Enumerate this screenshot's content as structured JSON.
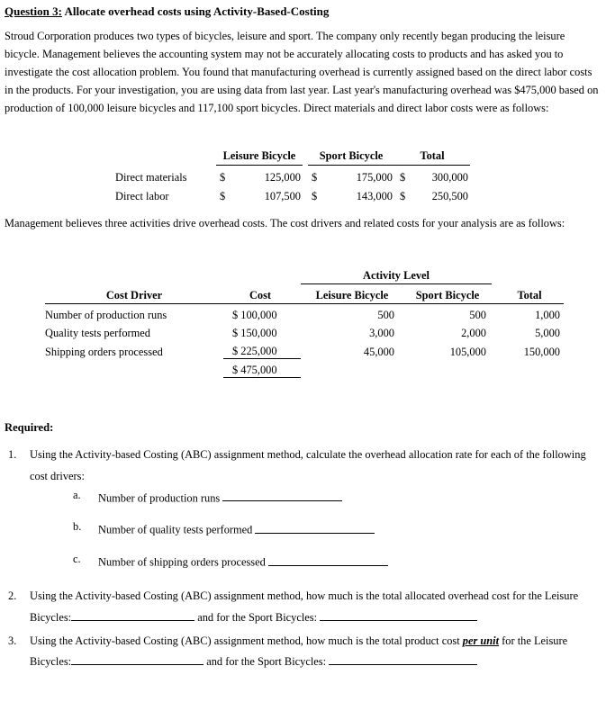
{
  "heading": {
    "question_label": "Question 3:",
    "question_title": " Allocate overhead costs using Activity-Based-Costing"
  },
  "intro_paragraph": "Stroud Corporation produces two types of bicycles, leisure and sport. The company only recently began producing the leisure bicycle. Management believes the accounting system may not be accurately allocating costs to products and has asked you to investigate the cost allocation problem. You found that manufacturing overhead is currently assigned based on the direct labor costs in the products. For your investigation, you are using data from last year. Last year's manufacturing overhead was $475,000 based on production of 100,000 leisure bicycles and 117,100 sport bicycles. Direct materials and direct labor costs were as follows:",
  "mid_paragraph": "Management believes three activities drive overhead costs. The cost drivers and related costs for your analysis are as follows:",
  "cost_table": {
    "headers": [
      "Leisure Bicycle",
      "Sport Bicycle",
      "Total"
    ],
    "currency_symbol": "$",
    "rows": [
      {
        "label": "Direct materials",
        "leisure": "125,000",
        "sport": "175,000",
        "total": "300,000"
      },
      {
        "label": "Direct labor",
        "leisure": "107,500",
        "sport": "143,000",
        "total": "250,500"
      }
    ]
  },
  "driver_table": {
    "span_header": "Activity Level",
    "headers": {
      "driver": "Cost Driver",
      "cost": "Cost",
      "leisure": "Leisure Bicycle",
      "sport": "Sport Bicycle",
      "total": "Total"
    },
    "rows": [
      {
        "driver": "Number of production runs",
        "cost": "$ 100,000",
        "leisure": "500",
        "sport": "500",
        "total": "1,000"
      },
      {
        "driver": "Quality tests performed",
        "cost": "$ 150,000",
        "leisure": "3,000",
        "sport": "2,000",
        "total": "5,000"
      },
      {
        "driver": "Shipping orders processed",
        "cost": "$ 225,000",
        "leisure": "45,000",
        "sport": "105,000",
        "total": "150,000"
      }
    ],
    "cost_total": "$  475,000"
  },
  "required": {
    "title": "Required:",
    "items": [
      {
        "number": "1.",
        "text": "Using the Activity-based Costing (ABC) assignment method, calculate the overhead allocation rate for each of the following cost drivers:",
        "subitems": [
          {
            "letter": "a.",
            "text": "Number of production runs"
          },
          {
            "letter": "b.",
            "text": "Number of quality tests performed"
          },
          {
            "letter": "c.",
            "text": "Number of shipping orders processed"
          }
        ]
      },
      {
        "number": "2.",
        "text_part1": "Using the Activity-based Costing (ABC) assignment method, how much is the total allocated overhead cost for the Leisure Bicycles:",
        "text_part2": " and for the Sport Bicycles: "
      },
      {
        "number": "3.",
        "text_part1": "Using the Activity-based Costing (ABC) assignment method, how much is the total product cost ",
        "emphasis": "per unit",
        "text_part2": " for the Leisure Bicycles:",
        "text_part3": " and for the Sport Bicycles: "
      }
    ]
  }
}
